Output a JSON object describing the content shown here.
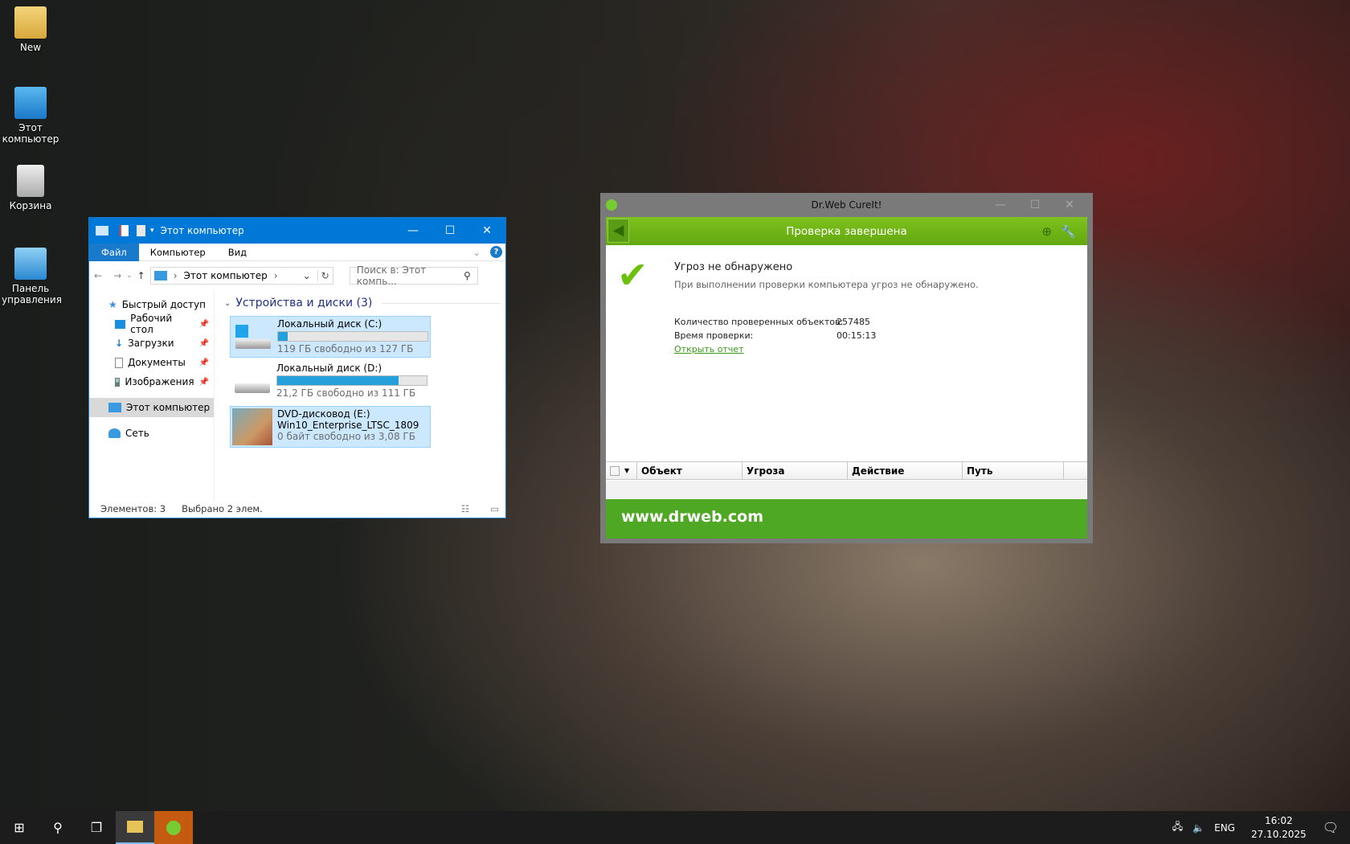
{
  "desktop": {
    "icons": [
      {
        "label": "New"
      },
      {
        "label": "Этот компьютер"
      },
      {
        "label": "Корзина"
      },
      {
        "label": "Панель управления"
      }
    ]
  },
  "explorer": {
    "title": "Этот компьютер",
    "ribbon_tabs": [
      "Файл",
      "Компьютер",
      "Вид"
    ],
    "address": "Этот компьютер",
    "search_placeholder": "Поиск в: Этот компь...",
    "nav": {
      "quick_access": "Быстрый доступ",
      "items": [
        "Рабочий стол",
        "Загрузки",
        "Документы",
        "Изображения"
      ],
      "this_pc": "Этот компьютер",
      "network": "Сеть"
    },
    "group": "Устройства и диски (3)",
    "drives": [
      {
        "name": "Локальный диск (C:)",
        "free": "119 ГБ свободно из 127 ГБ",
        "used_fraction": 0.063,
        "selected": true
      },
      {
        "name": "Локальный диск (D:)",
        "free": "21,2 ГБ свободно из 111 ГБ",
        "used_fraction": 0.81,
        "selected": false
      },
      {
        "name": "DVD-дисковод (E:)",
        "label": "Win10_Enterprise_LTSC_1809",
        "free": "0 байт свободно из 3,08 ГБ",
        "selected": true
      }
    ],
    "status_items": "Элементов: 3",
    "status_selected": "Выбрано 2 элем."
  },
  "drweb": {
    "title": "Dr.Web CureIt!",
    "header": "Проверка завершена",
    "result_title": "Угроз не обнаружено",
    "result_desc": "При выполнении проверки компьютера угроз не обнаружено.",
    "objects_label": "Количество проверенных объектов:",
    "objects_value": "257485",
    "time_label": "Время проверки:",
    "time_value": "00:15:13",
    "report_link": "Открыть отчет",
    "columns": [
      "Объект",
      "Угроза",
      "Действие",
      "Путь"
    ],
    "footer": "www.drweb.com"
  },
  "taskbar": {
    "lang": "ENG",
    "time": "16:02",
    "date": "27.10.2025"
  }
}
